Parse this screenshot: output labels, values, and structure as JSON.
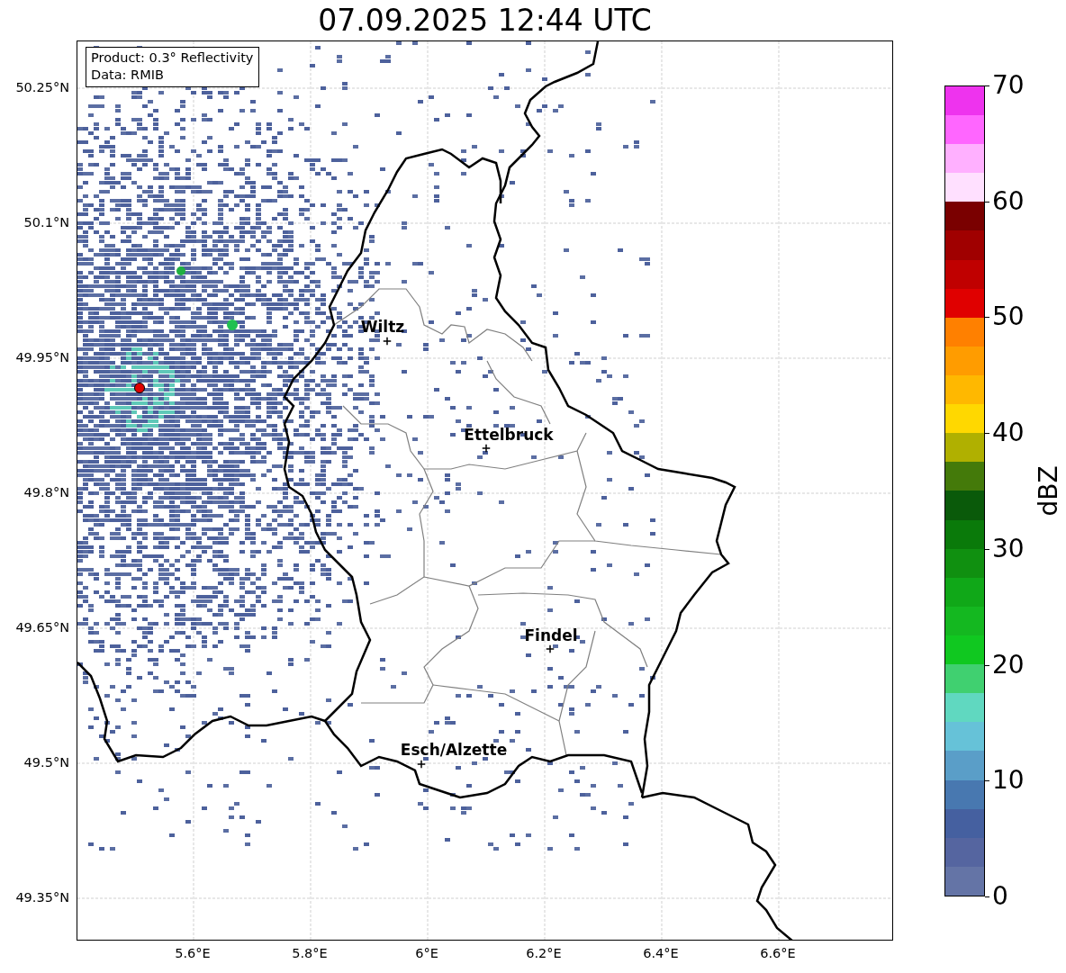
{
  "title": "07.09.2025 12:44 UTC",
  "info_box": {
    "lines": [
      "Product: 0.3° Reflectivity",
      "Data: RMIB"
    ]
  },
  "map": {
    "y_ticks": [
      "50.25°N",
      "50.1°N",
      "49.95°N",
      "49.8°N",
      "49.65°N",
      "49.5°N",
      "49.35°N"
    ],
    "x_ticks": [
      "5.6°E",
      "5.8°E",
      "6°E",
      "6.2°E",
      "6.4°E",
      "6.6°E"
    ],
    "cities": [
      "Wiltz",
      "Ettelbruck",
      "Findel",
      "Esch/Alzette"
    ]
  },
  "colorbar": {
    "label": "dBZ",
    "ticks": [
      "70",
      "60",
      "50",
      "40",
      "30",
      "20",
      "10",
      "0"
    ],
    "bands": [
      {
        "color": "#6474a6"
      },
      {
        "color": "#5565a0"
      },
      {
        "color": "#4560a0"
      },
      {
        "color": "#4878b0"
      },
      {
        "color": "#5a9ec8"
      },
      {
        "color": "#66c2d8"
      },
      {
        "color": "#60d8c0"
      },
      {
        "color": "#40d070"
      },
      {
        "color": "#10c820"
      },
      {
        "color": "#14b820"
      },
      {
        "color": "#10a818"
      },
      {
        "color": "#109010"
      },
      {
        "color": "#0a7a0a"
      },
      {
        "color": "#0a5a0a"
      },
      {
        "color": "#447a0a"
      },
      {
        "color": "#b0b000"
      },
      {
        "color": "#ffd800"
      },
      {
        "color": "#ffb800"
      },
      {
        "color": "#ff9c00"
      },
      {
        "color": "#ff8000"
      },
      {
        "color": "#e00000"
      },
      {
        "color": "#c00000"
      },
      {
        "color": "#a00000"
      },
      {
        "color": "#7a0000"
      },
      {
        "color": "#ffe0ff"
      },
      {
        "color": "#ffb0ff"
      },
      {
        "color": "#ff66ff"
      },
      {
        "color": "#ee33ee"
      }
    ]
  }
}
